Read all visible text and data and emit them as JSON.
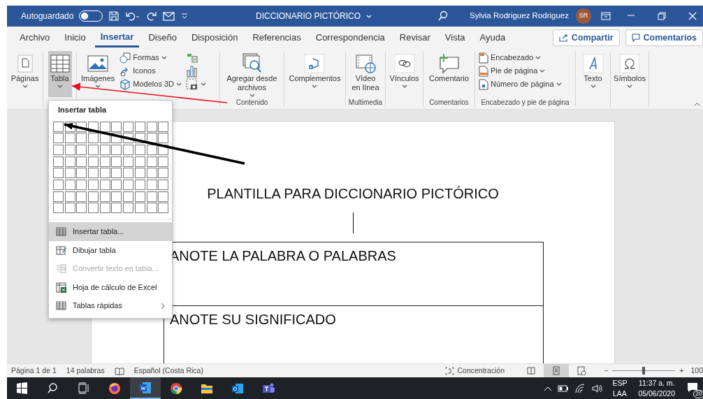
{
  "title_bar": {
    "autosave_label": "Autoguardado",
    "autosave_on": false,
    "document_title": "DICCIONARIO PICTÓRICO",
    "user_name": "Sylvia Rodriguez Rodriguez",
    "user_initials": "SR"
  },
  "tabs": [
    {
      "label": "Archivo",
      "selected": false
    },
    {
      "label": "Inicio",
      "selected": false
    },
    {
      "label": "Insertar",
      "selected": true
    },
    {
      "label": "Diseño",
      "selected": false
    },
    {
      "label": "Disposición",
      "selected": false
    },
    {
      "label": "Referencias",
      "selected": false
    },
    {
      "label": "Correspondencia",
      "selected": false
    },
    {
      "label": "Revisar",
      "selected": false
    },
    {
      "label": "Vista",
      "selected": false
    },
    {
      "label": "Ayuda",
      "selected": false
    }
  ],
  "share_button": "Compartir",
  "comments_button": "Comentarios",
  "ribbon": [
    {
      "items": [
        {
          "kind": "large",
          "label": "Páginas",
          "dropdown": true,
          "pressed": false
        }
      ]
    },
    {
      "items": [
        {
          "kind": "large",
          "label": "Tabla",
          "dropdown": true,
          "pressed": true
        }
      ]
    },
    {
      "items": [
        {
          "kind": "large",
          "label": "Imágenes",
          "dropdown": true,
          "pressed": false
        },
        {
          "kind": "small",
          "label": "Formas",
          "dropdown": true,
          "pressed": false
        },
        {
          "kind": "small",
          "label": "Iconos",
          "dropdown": false,
          "pressed": false
        },
        {
          "kind": "small",
          "label": "Modelos 3D",
          "dropdown": true,
          "pressed": false
        },
        {
          "kind": "icon",
          "dropdown": false,
          "pressed": false
        },
        {
          "kind": "icon",
          "dropdown": false,
          "pressed": false
        },
        {
          "kind": "icon",
          "dropdown": true,
          "pressed": false
        }
      ]
    },
    {
      "label": "Contenido",
      "items": [
        {
          "kind": "large",
          "label": "Agregar desde archivos",
          "dropdown": true,
          "pressed": false
        }
      ]
    },
    {
      "items": [
        {
          "kind": "large",
          "label": "Complementos",
          "dropdown": true,
          "pressed": false
        }
      ]
    },
    {
      "label": "Multimedia",
      "items": [
        {
          "kind": "large",
          "label": "Vídeo en línea",
          "dropdown": false,
          "pressed": false
        }
      ]
    },
    {
      "items": [
        {
          "kind": "large",
          "label": "Vínculos",
          "dropdown": true,
          "pressed": false
        }
      ]
    },
    {
      "label": "Comentarios",
      "items": [
        {
          "kind": "large",
          "label": "Comentario",
          "dropdown": false,
          "pressed": false
        }
      ]
    },
    {
      "label": "Encabezado y pie de página",
      "items": [
        {
          "kind": "small",
          "label": "Encabezado",
          "dropdown": true,
          "pressed": false
        },
        {
          "kind": "small",
          "label": "Pie de página",
          "dropdown": true,
          "pressed": false
        },
        {
          "kind": "small",
          "label": "Número de página",
          "dropdown": true,
          "pressed": false
        }
      ]
    },
    {
      "items": [
        {
          "kind": "large",
          "label": "Texto",
          "dropdown": true,
          "pressed": false
        }
      ]
    },
    {
      "items": [
        {
          "kind": "large",
          "label": "Símbolos",
          "dropdown": true,
          "pressed": false
        }
      ]
    }
  ],
  "table_menu": {
    "title": "Insertar tabla",
    "items": [
      {
        "label": "Insertar tabla...",
        "selected": true,
        "disabled": false,
        "submenu": false
      },
      {
        "label": "Dibujar tabla",
        "selected": false,
        "disabled": false,
        "submenu": false
      },
      {
        "label": "Convertir texto en tabla...",
        "selected": false,
        "disabled": true,
        "submenu": false
      },
      {
        "label": "Hoja de cálculo de Excel",
        "selected": false,
        "disabled": false,
        "submenu": false
      },
      {
        "label": "Tablas rápidas",
        "selected": false,
        "disabled": false,
        "submenu": true
      }
    ]
  },
  "document": {
    "heading": "PLANTILLA PARA DICCIONARIO PICTÓRICO",
    "table_rows": [
      "ANOTE LA PALABRA O PALABRAS",
      "ANOTE SU SIGNIFICADO"
    ]
  },
  "status_bar": {
    "page": "Página 1 de 1",
    "words": "14 palabras",
    "language": "Español (Costa Rica)",
    "focus": "Concentración",
    "views": [
      {
        "selected": false
      },
      {
        "selected": true
      },
      {
        "selected": false
      }
    ],
    "zoom_minus": "−",
    "zoom_plus": "+",
    "zoom": {
      "level": 0.5
    },
    "zoom_text": "100"
  },
  "taskbar": {
    "apps": [
      {
        "selected": false
      },
      {
        "selected": false
      },
      {
        "selected": false
      },
      {
        "selected": false
      },
      {
        "selected": true
      },
      {
        "selected": false
      },
      {
        "selected": false
      },
      {
        "selected": false
      },
      {
        "selected": false
      }
    ],
    "language": "ESP",
    "layout": "LAA",
    "time": "11:37 a. m.",
    "date": "05/06/2020",
    "notifications": "20"
  }
}
